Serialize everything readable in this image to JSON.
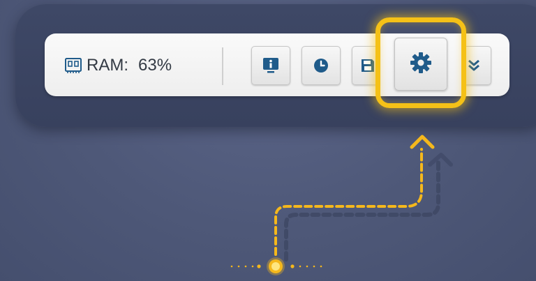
{
  "toolbar": {
    "ram_label": "RAM:",
    "ram_value": "63%"
  },
  "icons": {
    "memory": "memory-chip-icon",
    "info": "info-icon",
    "clock": "clock-icon",
    "save": "save-icon",
    "settings": "gear-icon",
    "expand": "chevron-double-down-icon"
  },
  "colors": {
    "accent": "#f5c117",
    "icon": "#1f5b8a",
    "background": "#4e5878",
    "panel": "#3b4462"
  }
}
